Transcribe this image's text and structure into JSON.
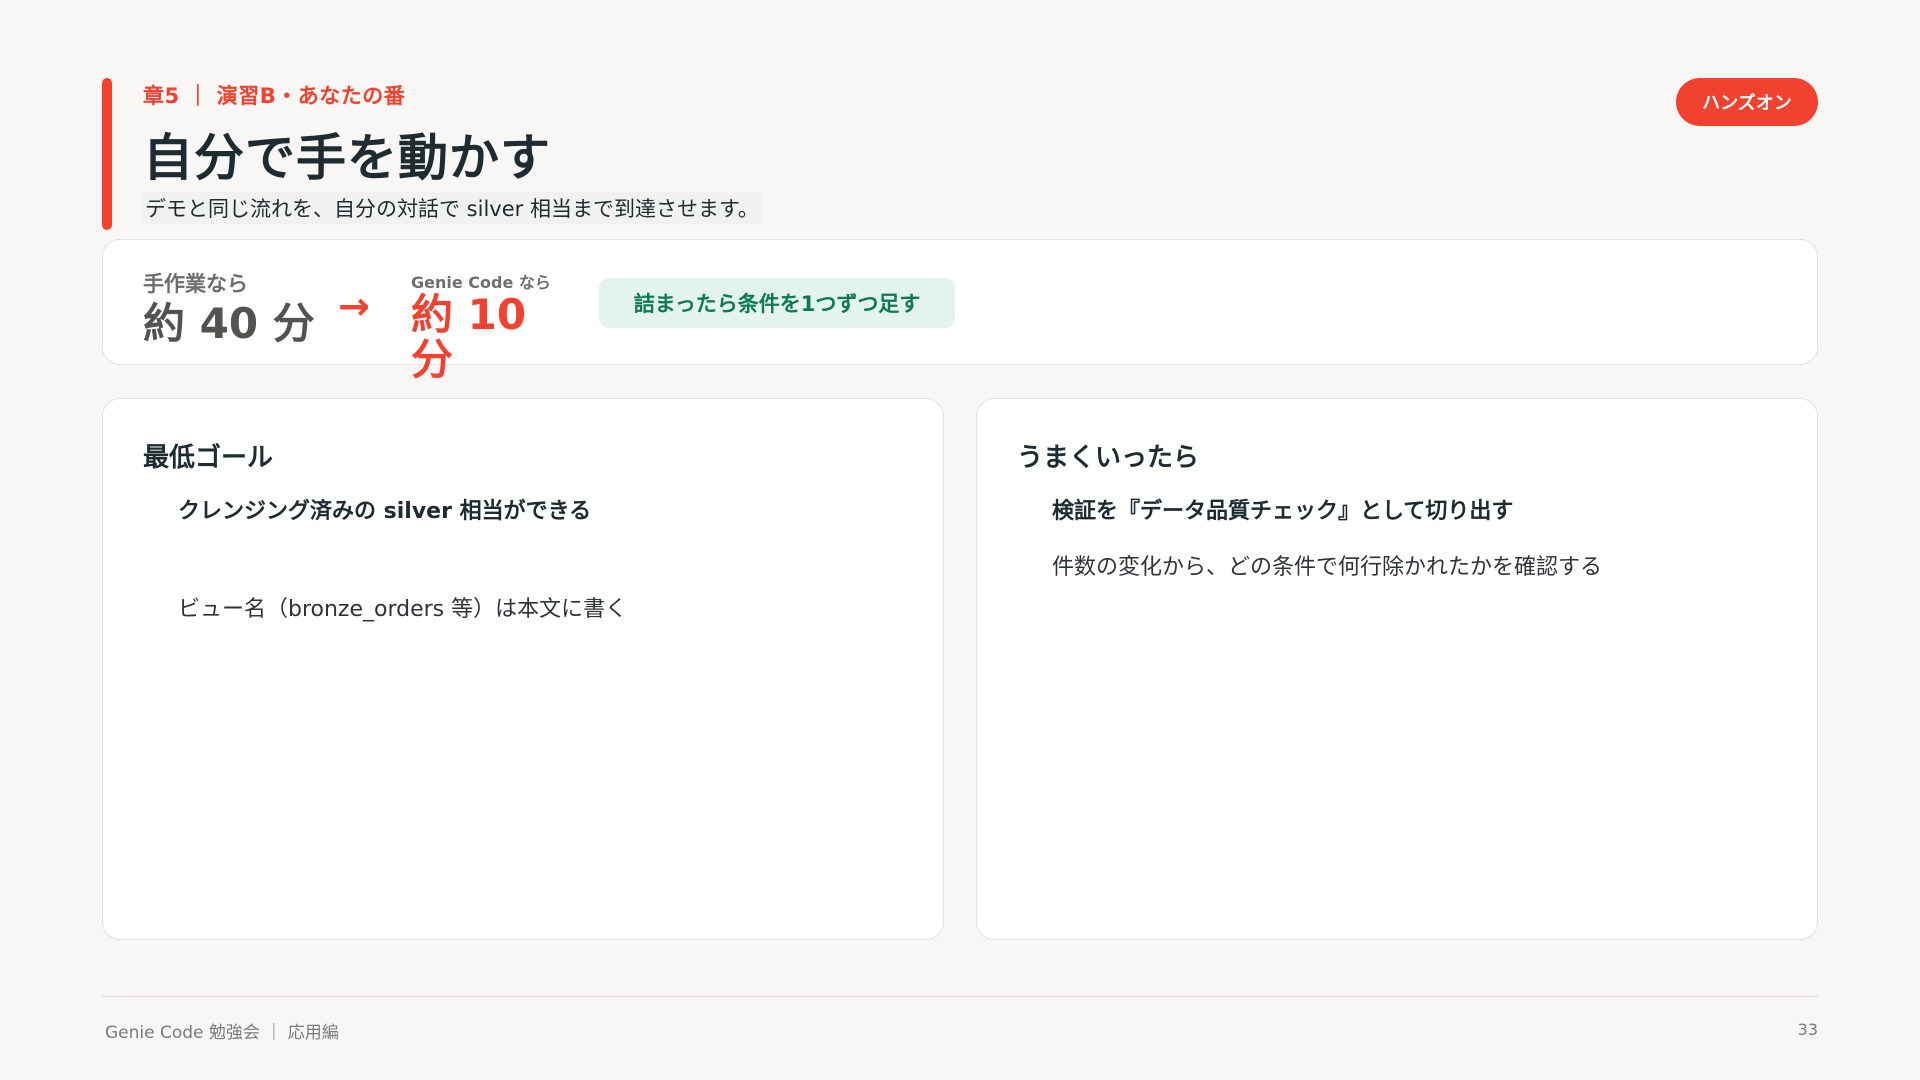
{
  "header": {
    "chapter": "章5 ｜ 演習B・あなたの番",
    "title": "自分で手を動かす",
    "subtitle": "デモと同じ流れを、自分の対話で silver 相当まで到達させます。",
    "badge": "ハンズオン"
  },
  "comparison": {
    "manual_label": "手作業なら",
    "manual_value": "約 40 分",
    "arrow": "→",
    "genie_label": "Genie Code なら",
    "genie_value": "約 10 分",
    "tip": "詰まったら条件を1つずつ足す"
  },
  "goals": {
    "minimum": {
      "heading": "最低ゴール",
      "item": "クレンジング済みの silver 相当ができる",
      "note": "ビュー名（bronze_orders 等）は本文に書く"
    },
    "stretch": {
      "heading": "うまくいったら",
      "item": "検証を『データ品質チェック』として切り出す",
      "note": "件数の変化から、どの条件で何行除かれたかを確認する"
    }
  },
  "footer": {
    "text": "Genie Code 勉強会 ｜ 応用編",
    "page_number": "33"
  },
  "colors": {
    "accent": "#f2412e",
    "tip_bg": "#e3f3ee",
    "tip_text": "#0f7a52",
    "background": "#f8f7f5"
  }
}
